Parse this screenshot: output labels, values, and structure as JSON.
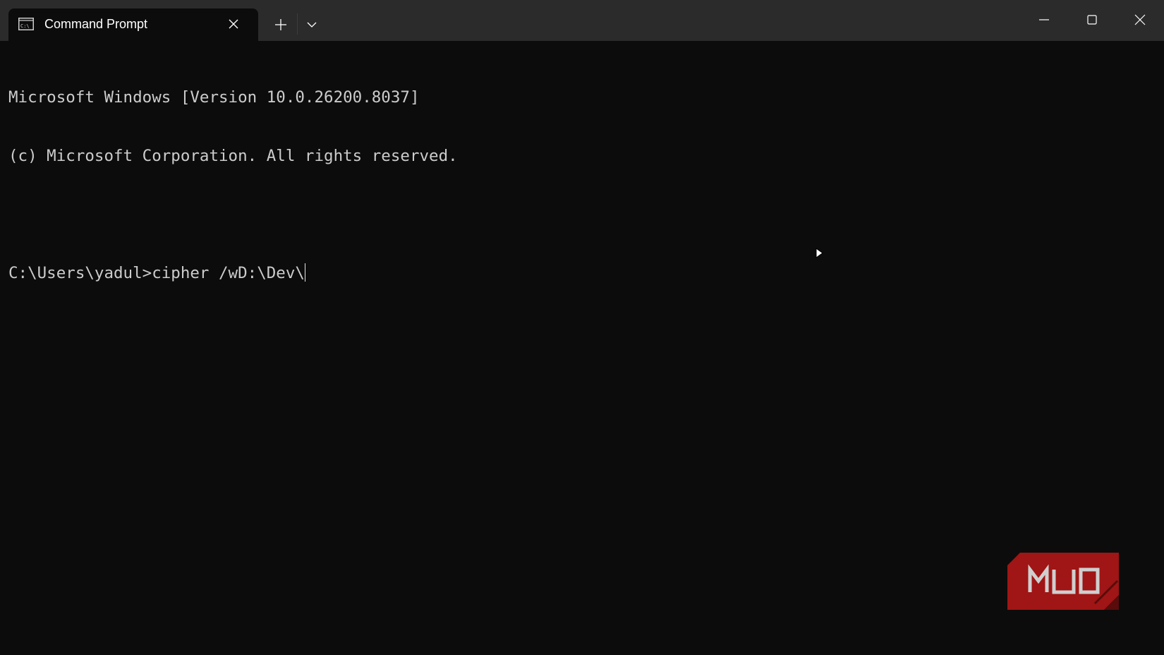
{
  "window": {
    "tab_title": "Command Prompt",
    "tab_icon": "cmd-icon",
    "controls": [
      "minimize-icon",
      "maximize-icon",
      "close-icon"
    ]
  },
  "terminal": {
    "lines": [
      "Microsoft Windows [Version 10.0.26200.8037]",
      "(c) Microsoft Corporation. All rights reserved.",
      "",
      "C:\\Users\\yadul>cipher /wD:\\Dev\\"
    ]
  },
  "watermark": {
    "text": "MUO"
  },
  "colors": {
    "titlebar": "#2b2b2b",
    "terminal_bg": "#0c0c0c",
    "text": "#cccccc",
    "logo_red": "#c8102e"
  }
}
